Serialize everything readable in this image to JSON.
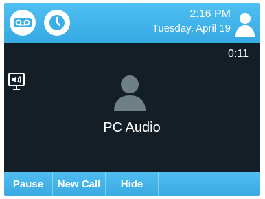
{
  "status_bar": {
    "time": "2:16 PM",
    "date": "Tuesday, April 19",
    "icons": [
      "voicemail-icon",
      "clock-icon",
      "user-icon"
    ],
    "color": "#3fb2e8"
  },
  "call": {
    "duration": "0:11",
    "contact_name": "PC Audio",
    "icons": [
      "speaker-icon",
      "contact-avatar-icon"
    ],
    "background": "#131e26"
  },
  "softkeys": {
    "pause": "Pause",
    "new_call": "New Call",
    "hide": "Hide"
  }
}
